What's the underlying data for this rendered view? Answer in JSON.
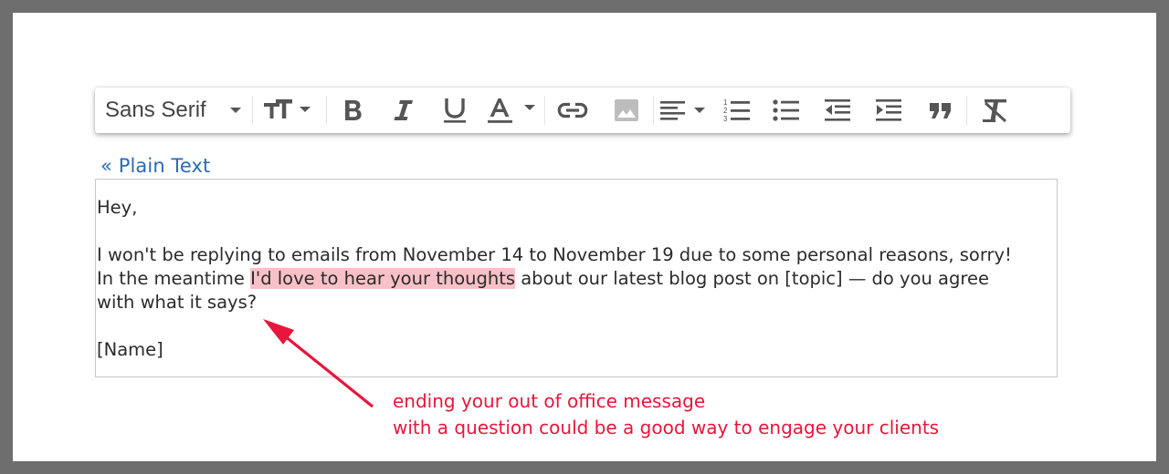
{
  "toolbar": {
    "font_family": "Sans Serif",
    "buttons": [
      "font-size",
      "bold",
      "italic",
      "underline",
      "text-color",
      "link",
      "image",
      "align",
      "numbered-list",
      "bulleted-list",
      "indent-less",
      "indent-more",
      "quote",
      "remove-formatting"
    ]
  },
  "plain_text_link": "« Plain Text",
  "editor": {
    "greeting": "Hey,",
    "line1": "I won't be replying to emails from November 14 to November 19 due to some personal reasons, sorry!",
    "line2_before": "In the meantime ",
    "line2_highlight": "I'd love to hear your thoughts",
    "line2_after": " about our latest blog post on [topic] — do you agree",
    "line3": "with what it says?",
    "signature": "[Name]"
  },
  "annotation": {
    "line1": "ending your out of office message",
    "line2": "with a question could be a good way to engage your clients"
  },
  "colors": {
    "highlight": "#f9c1c7",
    "annotation": "#e8163c",
    "link": "#2a6ab5",
    "frame": "#6e6e6e"
  }
}
